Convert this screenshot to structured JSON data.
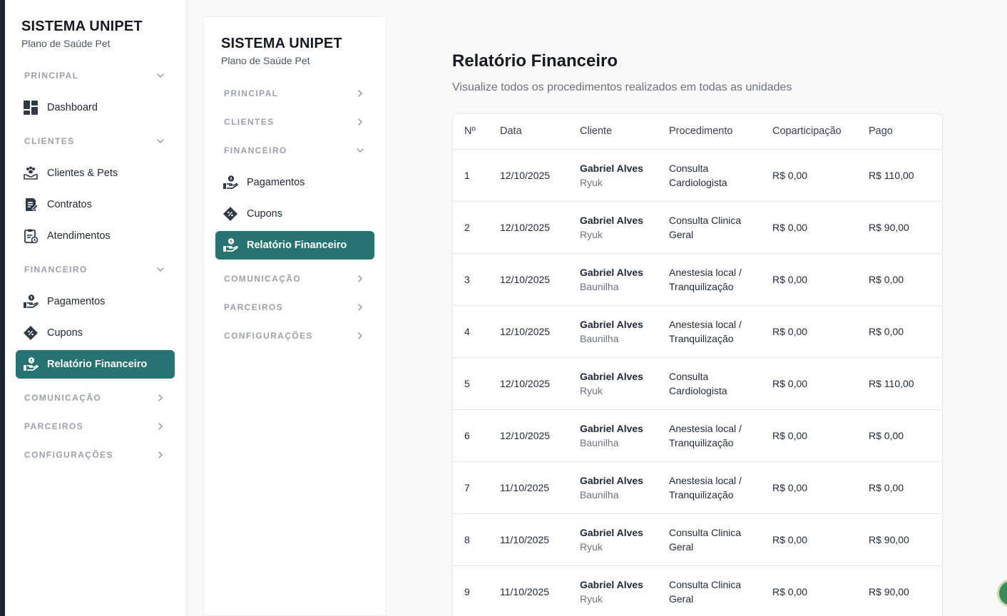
{
  "brand": {
    "title": "SISTEMA UNIPET",
    "subtitle": "Plano de Saúde Pet"
  },
  "colors": {
    "accent": "#267371",
    "sidebar_bg": "#ffffff",
    "page_bg": "#f8f8f7"
  },
  "sidebar": {
    "sections": {
      "principal": {
        "label": "PRINCIPAL",
        "expanded": true,
        "items": [
          {
            "label": "Dashboard",
            "icon": "dashboard-icon"
          }
        ]
      },
      "clientes": {
        "label": "CLIENTES",
        "expanded": true,
        "items": [
          {
            "label": "Clientes & Pets",
            "icon": "paw-hand-icon"
          },
          {
            "label": "Contratos",
            "icon": "contract-icon"
          },
          {
            "label": "Atendimentos",
            "icon": "clipboard-icon"
          }
        ]
      },
      "financeiro": {
        "label": "FINANCEIRO",
        "expanded": true,
        "items": [
          {
            "label": "Pagamentos",
            "icon": "payment-hand-icon"
          },
          {
            "label": "Cupons",
            "icon": "coupon-icon"
          },
          {
            "label": "Relatório Financeiro",
            "icon": "payment-hand-icon",
            "active": true
          }
        ]
      },
      "comunicacao": {
        "label": "COMUNICAÇÃO",
        "expanded": false
      },
      "parceiros": {
        "label": "PARCEIROS",
        "expanded": false
      },
      "configuracoes": {
        "label": "CONFIGURAÇÕES",
        "expanded": false
      }
    }
  },
  "main": {
    "title": "Relatório Financeiro",
    "subtitle": "Visualize todos os procedimentos realizados em todas as unidades",
    "table": {
      "headers": [
        "Nº",
        "Data",
        "Cliente",
        "Procedimento",
        "Coparticipação",
        "Pago"
      ],
      "rows": [
        {
          "num": "1",
          "date": "12/10/2025",
          "client": "Gabriel Alves",
          "pet": "Ryuk",
          "proc1": "Consulta",
          "proc2": "Cardiologista",
          "copart": "R$ 0,00",
          "paid": "R$ 110,00"
        },
        {
          "num": "2",
          "date": "12/10/2025",
          "client": "Gabriel Alves",
          "pet": "Ryuk",
          "proc1": "Consulta Clinica",
          "proc2": "Geral",
          "copart": "R$ 0,00",
          "paid": "R$ 90,00"
        },
        {
          "num": "3",
          "date": "12/10/2025",
          "client": "Gabriel Alves",
          "pet": "Baunilha",
          "proc1": "Anestesia local /",
          "proc2": "Tranquilização",
          "copart": "R$ 0,00",
          "paid": "R$ 0,00"
        },
        {
          "num": "4",
          "date": "12/10/2025",
          "client": "Gabriel Alves",
          "pet": "Baunilha",
          "proc1": "Anestesia local /",
          "proc2": "Tranquilização",
          "copart": "R$ 0,00",
          "paid": "R$ 0,00"
        },
        {
          "num": "5",
          "date": "12/10/2025",
          "client": "Gabriel Alves",
          "pet": "Ryuk",
          "proc1": "Consulta",
          "proc2": "Cardiologista",
          "copart": "R$ 0,00",
          "paid": "R$ 110,00"
        },
        {
          "num": "6",
          "date": "12/10/2025",
          "client": "Gabriel Alves",
          "pet": "Baunilha",
          "proc1": "Anestesia local /",
          "proc2": "Tranquilização",
          "copart": "R$ 0,00",
          "paid": "R$ 0,00"
        },
        {
          "num": "7",
          "date": "11/10/2025",
          "client": "Gabriel Alves",
          "pet": "Baunilha",
          "proc1": "Anestesia local /",
          "proc2": "Tranquilização",
          "copart": "R$ 0,00",
          "paid": "R$ 0,00"
        },
        {
          "num": "8",
          "date": "11/10/2025",
          "client": "Gabriel Alves",
          "pet": "Ryuk",
          "proc1": "Consulta Clinica",
          "proc2": "Geral",
          "copart": "R$ 0,00",
          "paid": "R$ 90,00"
        },
        {
          "num": "9",
          "date": "11/10/2025",
          "client": "Gabriel Alves",
          "pet": "Ryuk",
          "proc1": "Consulta Clinica",
          "proc2": "Geral",
          "copart": "R$ 0,00",
          "paid": "R$ 90,00"
        }
      ]
    }
  }
}
